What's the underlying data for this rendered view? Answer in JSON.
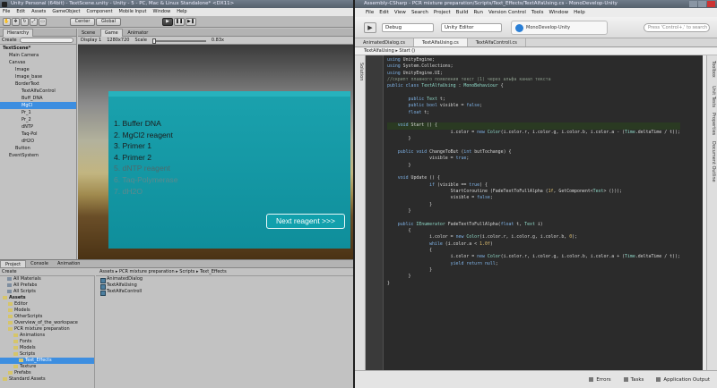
{
  "unity": {
    "title": "Unity Personal (64bit) - TextScene.unity - Unity - 5 - PC, Mac & Linux Standalone* <DX11>",
    "menu": [
      "File",
      "Edit",
      "Assets",
      "GameObject",
      "Component",
      "Mobile Input",
      "Window",
      "Help"
    ],
    "toolbar": {
      "center": "Center",
      "global": "Global"
    },
    "hierarchy": {
      "tab": "Hierarchy",
      "create": "Create",
      "rows": [
        {
          "label": "TextScene*",
          "indent": 0,
          "bold": true
        },
        {
          "label": "Main Camera",
          "indent": 1
        },
        {
          "label": "Canvas",
          "indent": 1
        },
        {
          "label": "Image",
          "indent": 2
        },
        {
          "label": "Image_base",
          "indent": 2
        },
        {
          "label": "BorderText",
          "indent": 2
        },
        {
          "label": "TextAlfaControl",
          "indent": 3
        },
        {
          "label": "Buff_DNA",
          "indent": 3
        },
        {
          "label": "MgCl",
          "indent": 3,
          "selected": true
        },
        {
          "label": "Pr_1",
          "indent": 3
        },
        {
          "label": "Pr_2",
          "indent": 3
        },
        {
          "label": "dNTP",
          "indent": 3
        },
        {
          "label": "Taq-Pol",
          "indent": 3
        },
        {
          "label": "dH2O",
          "indent": 3
        },
        {
          "label": "Button",
          "indent": 2
        },
        {
          "label": "EventSystem",
          "indent": 1
        }
      ]
    },
    "game": {
      "tabs": [
        "Scene",
        "Game",
        "Animator"
      ],
      "display": "Display 1",
      "resolution": "1280x720",
      "scale_label": "Scale",
      "scale_value": "0.83x"
    },
    "dialog": {
      "items": [
        {
          "text": "1. Buffer DNA",
          "style": "normal"
        },
        {
          "text": "2. MgCl2 reagent",
          "style": "normal"
        },
        {
          "text": "3. Primer 1",
          "style": "normal"
        },
        {
          "text": "4. Primer 2",
          "style": "normal"
        },
        {
          "text": "5. dNTP reagent",
          "style": "faded"
        },
        {
          "text": "6. Taq-Polymerase",
          "style": "faint"
        },
        {
          "text": "7. dH2O",
          "style": "faint"
        }
      ],
      "next_button": "Next reagent >>>"
    },
    "project": {
      "tabs": [
        "Project",
        "Console",
        "Animation"
      ],
      "create": "Create",
      "favorites": [
        {
          "label": "All Materials"
        },
        {
          "label": "All Prefabs"
        },
        {
          "label": "All Scripts"
        }
      ],
      "folders": [
        {
          "label": "Assets",
          "indent": 0,
          "bold": true
        },
        {
          "label": "Editor",
          "indent": 1
        },
        {
          "label": "Models",
          "indent": 1
        },
        {
          "label": "OtherScripts",
          "indent": 1
        },
        {
          "label": "Overview_of_the_workspace",
          "indent": 1
        },
        {
          "label": "PCR mixture preparation",
          "indent": 1
        },
        {
          "label": "Animations",
          "indent": 2
        },
        {
          "label": "Fonts",
          "indent": 2
        },
        {
          "label": "Models",
          "indent": 2
        },
        {
          "label": "Scripts",
          "indent": 2
        },
        {
          "label": "Text_Effects",
          "indent": 3,
          "selected": true
        },
        {
          "label": "Texture",
          "indent": 2
        },
        {
          "label": "Prefabs",
          "indent": 1
        },
        {
          "label": "Standard Assets",
          "indent": 0
        }
      ],
      "breadcrumb": "Assets ▸ PCR mixture preparation ▸ Scripts ▸ Text_Effects",
      "files": [
        "AnimatedDialog",
        "TextAlfaUsing",
        "TextAlfaControll"
      ]
    }
  },
  "mono": {
    "title": "Assembly-CSharp - PCR mixture preparation/Scripts/Text_Effects/TextAlfaUsing.cs - MonoDevelop-Unity",
    "menu": [
      "File",
      "Edit",
      "View",
      "Search",
      "Project",
      "Build",
      "Run",
      "Version Control",
      "Tools",
      "Window",
      "Help"
    ],
    "toolbar": {
      "config": "Debug",
      "target": "Unity Editor",
      "status": "MonoDevelop-Unity",
      "search_placeholder": "Press 'Control+,' to search"
    },
    "tabs": [
      "AnimatedDialog.cs",
      "TextAlfaUsing.cs",
      "TextAlfaControll.cs"
    ],
    "crumb": "TextAlfaUsing  ▸  Start ()",
    "code": [
      [
        {
          "t": "using ",
          "c": "kw"
        },
        {
          "t": "UnityEngine;",
          "c": ""
        }
      ],
      [
        {
          "t": "using ",
          "c": "kw"
        },
        {
          "t": "System.Collections;",
          "c": ""
        }
      ],
      [
        {
          "t": "using ",
          "c": "kw"
        },
        {
          "t": "UnityEngine.UI;",
          "c": ""
        }
      ],
      [
        {
          "t": "//скрипт плавного появления текст (1) через альфа канал текста",
          "c": "cm"
        }
      ],
      [
        {
          "t": "public class ",
          "c": "kw"
        },
        {
          "t": "TextAlfaUsing",
          "c": "ty"
        },
        {
          "t": " : ",
          "c": ""
        },
        {
          "t": "MonoBehaviour",
          "c": "ty"
        },
        {
          "t": " {",
          "c": ""
        }
      ],
      [
        {
          "t": "",
          "c": ""
        }
      ],
      [
        {
          "t": "        public ",
          "c": "kw"
        },
        {
          "t": "Text",
          "c": "ty"
        },
        {
          "t": " t;",
          "c": ""
        }
      ],
      [
        {
          "t": "        public bool ",
          "c": "kw"
        },
        {
          "t": "visible = ",
          "c": ""
        },
        {
          "t": "false",
          "c": "kw"
        },
        {
          "t": ";",
          "c": ""
        }
      ],
      [
        {
          "t": "        float ",
          "c": "kw"
        },
        {
          "t": "t;",
          "c": ""
        }
      ],
      [
        {
          "t": "",
          "c": ""
        }
      ],
      [
        {
          "t": "    void ",
          "c": "kw"
        },
        {
          "t": "Start () {",
          "c": ""
        }
      ],
      [
        {
          "t": "                        i.color = ",
          "c": ""
        },
        {
          "t": "new ",
          "c": "kw"
        },
        {
          "t": "Color",
          "c": "ty"
        },
        {
          "t": "(i.color.r, i.color.g, i.color.b, i.color.a - (",
          "c": ""
        },
        {
          "t": "Time",
          "c": "ty"
        },
        {
          "t": ".deltaTime / t));",
          "c": ""
        }
      ],
      [
        {
          "t": "        }",
          "c": ""
        }
      ],
      [
        {
          "t": "",
          "c": ""
        }
      ],
      [
        {
          "t": "    public void ",
          "c": "kw"
        },
        {
          "t": "ChangeToBut (",
          "c": ""
        },
        {
          "t": "int ",
          "c": "kw"
        },
        {
          "t": "butTochange) {",
          "c": ""
        }
      ],
      [
        {
          "t": "                visible = ",
          "c": ""
        },
        {
          "t": "true",
          "c": "kw"
        },
        {
          "t": ";",
          "c": ""
        }
      ],
      [
        {
          "t": "        }",
          "c": ""
        }
      ],
      [
        {
          "t": "",
          "c": ""
        }
      ],
      [
        {
          "t": "    void ",
          "c": "kw"
        },
        {
          "t": "Update () {",
          "c": ""
        }
      ],
      [
        {
          "t": "                if ",
          "c": "kw"
        },
        {
          "t": "(visible == ",
          "c": ""
        },
        {
          "t": "true",
          "c": "kw"
        },
        {
          "t": ") {",
          "c": ""
        }
      ],
      [
        {
          "t": "                        StartCoroutine (FadeTextToFullAlpha (",
          "c": ""
        },
        {
          "t": "1f",
          "c": "st"
        },
        {
          "t": ", GetComponent<",
          "c": ""
        },
        {
          "t": "Text",
          "c": "ty"
        },
        {
          "t": "> ()));",
          "c": ""
        }
      ],
      [
        {
          "t": "                        visible = ",
          "c": ""
        },
        {
          "t": "false",
          "c": "kw"
        },
        {
          "t": ";",
          "c": ""
        }
      ],
      [
        {
          "t": "                }",
          "c": ""
        }
      ],
      [
        {
          "t": "        }",
          "c": ""
        }
      ],
      [
        {
          "t": "",
          "c": ""
        }
      ],
      [
        {
          "t": "    public ",
          "c": "kw"
        },
        {
          "t": "IEnumerator",
          "c": "ty"
        },
        {
          "t": " FadeTextToFullAlpha(",
          "c": ""
        },
        {
          "t": "float ",
          "c": "kw"
        },
        {
          "t": "t, ",
          "c": ""
        },
        {
          "t": "Text",
          "c": "ty"
        },
        {
          "t": " i)",
          "c": ""
        }
      ],
      [
        {
          "t": "        {",
          "c": ""
        }
      ],
      [
        {
          "t": "                i.color = ",
          "c": ""
        },
        {
          "t": "new ",
          "c": "kw"
        },
        {
          "t": "Color",
          "c": "ty"
        },
        {
          "t": "(i.color.r, i.color.g, i.color.b, ",
          "c": ""
        },
        {
          "t": "0",
          "c": "st"
        },
        {
          "t": ");",
          "c": ""
        }
      ],
      [
        {
          "t": "                while ",
          "c": "kw"
        },
        {
          "t": "(i.color.a < ",
          "c": ""
        },
        {
          "t": "1.0f",
          "c": "st"
        },
        {
          "t": ")",
          "c": ""
        }
      ],
      [
        {
          "t": "                {",
          "c": ""
        }
      ],
      [
        {
          "t": "                        i.color = ",
          "c": ""
        },
        {
          "t": "new ",
          "c": "kw"
        },
        {
          "t": "Color",
          "c": "ty"
        },
        {
          "t": "(i.color.r, i.color.g, i.color.b, i.color.a + (",
          "c": ""
        },
        {
          "t": "Time",
          "c": "ty"
        },
        {
          "t": ".deltaTime / t));",
          "c": ""
        }
      ],
      [
        {
          "t": "                        yield return null",
          "c": "kw"
        },
        {
          "t": ";",
          "c": ""
        }
      ],
      [
        {
          "t": "                }",
          "c": ""
        }
      ],
      [
        {
          "t": "        }",
          "c": ""
        }
      ],
      [
        {
          "t": "}",
          "c": ""
        }
      ]
    ],
    "current_line": 11,
    "right_panels": [
      "Toolbox",
      "Unit Tests",
      "Properties",
      "Document Outline"
    ],
    "left_panels": [
      "Solution"
    ],
    "statusbar": [
      "Errors",
      "Tasks",
      "Application Output"
    ]
  }
}
